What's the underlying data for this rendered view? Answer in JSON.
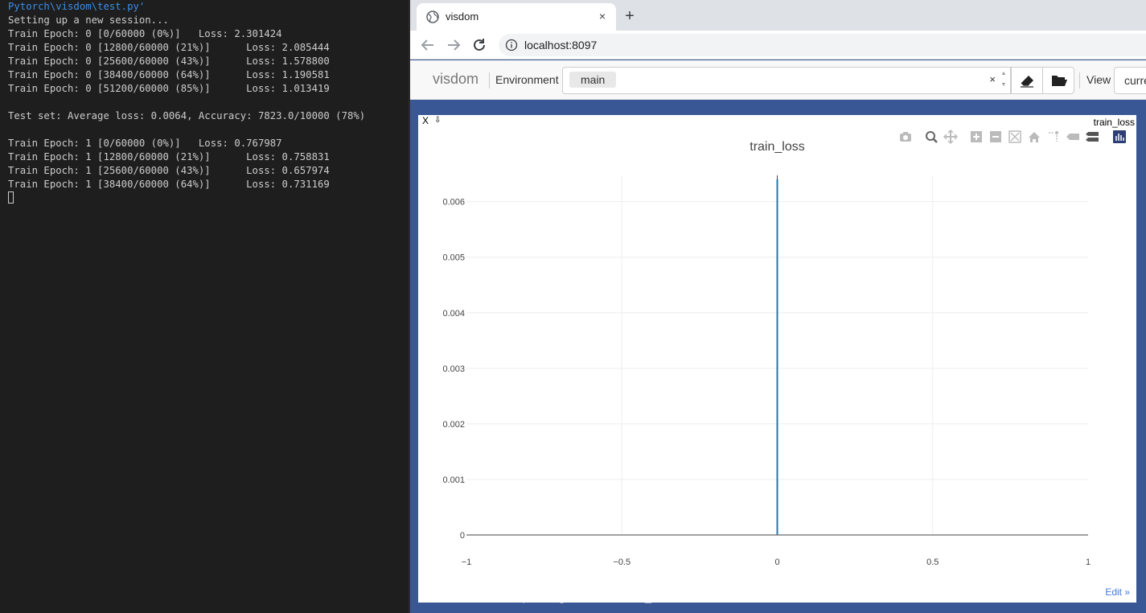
{
  "terminal": {
    "lines": [
      "Pytorch\\visdom\\test.py'",
      "Setting up a new session...",
      "Train Epoch: 0 [0/60000 (0%)]   Loss: 2.301424",
      "Train Epoch: 0 [12800/60000 (21%)]      Loss: 2.085444",
      "Train Epoch: 0 [25600/60000 (43%)]      Loss: 1.578800",
      "Train Epoch: 0 [38400/60000 (64%)]      Loss: 1.190581",
      "Train Epoch: 0 [51200/60000 (85%)]      Loss: 1.013419",
      "",
      "Test set: Average loss: 0.0064, Accuracy: 7823.0/10000 (78%)",
      "",
      "Train Epoch: 1 [0/60000 (0%)]   Loss: 0.767987",
      "Train Epoch: 1 [12800/60000 (21%)]      Loss: 0.758831",
      "Train Epoch: 1 [25600/60000 (43%)]      Loss: 0.657974",
      "Train Epoch: 1 [38400/60000 (64%)]      Loss: 0.731169"
    ]
  },
  "browser": {
    "tab_title": "visdom",
    "tab_close": "×",
    "new_tab": "+",
    "url": "localhost:8097"
  },
  "app": {
    "brand": "visdom",
    "environment_label": "Environment",
    "environment_selected": "main",
    "clear_symbol": "×",
    "view_label": "View",
    "view_value": "curre"
  },
  "pane": {
    "close_label": "X",
    "title": "train_loss",
    "edit_link": "Edit »"
  },
  "watermark": "https://blog.csdn.net/weixin_368...",
  "colors": {
    "line": "#1f77b4",
    "pane_bg": "#3a5795",
    "terminal_bg": "#1e1e1e"
  },
  "chart_data": {
    "type": "line",
    "title": "train_loss",
    "x": [
      0,
      0
    ],
    "series": [
      {
        "values": [
          0,
          0.0064
        ]
      }
    ],
    "xlim": [
      -1,
      1
    ],
    "ylim": [
      0,
      0.0064
    ],
    "x_ticks": [
      "−1",
      "−0.5",
      "0",
      "0.5",
      "1"
    ],
    "y_ticks": [
      "0",
      "0.001",
      "0.002",
      "0.003",
      "0.004",
      "0.005",
      "0.006"
    ],
    "grid": true
  }
}
